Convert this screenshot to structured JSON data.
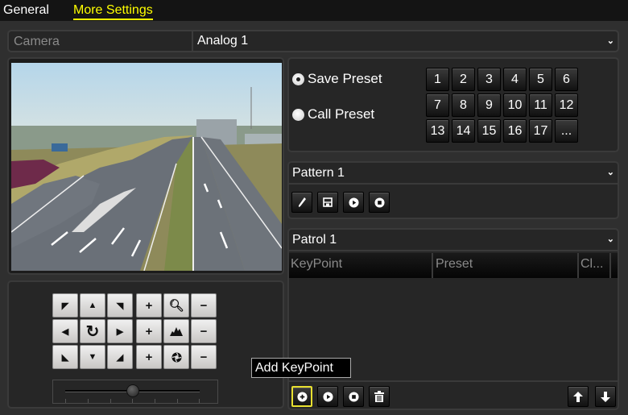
{
  "tabs": [
    {
      "label": "General",
      "active": false
    },
    {
      "label": "More Settings",
      "active": true
    }
  ],
  "camera": {
    "label": "Camera",
    "value": "Analog 1"
  },
  "preset": {
    "save_label": "Save Preset",
    "call_label": "Call Preset",
    "selected": "save",
    "numbers": [
      "1",
      "2",
      "3",
      "4",
      "5",
      "6",
      "7",
      "8",
      "9",
      "10",
      "11",
      "12",
      "13",
      "14",
      "15",
      "16",
      "17",
      "..."
    ]
  },
  "ptz": {
    "direction_icons": [
      "arrow-up-left-icon",
      "arrow-up-icon",
      "arrow-up-right-icon",
      "arrow-left-icon",
      "auto-scan-icon",
      "arrow-right-icon",
      "arrow-down-left-icon",
      "arrow-down-icon",
      "arrow-down-right-icon"
    ],
    "lens_rows": [
      {
        "name": "zoom",
        "icon": "zoom-icon",
        "plus": "+",
        "minus": "−"
      },
      {
        "name": "focus",
        "icon": "focus-icon",
        "plus": "+",
        "minus": "−"
      },
      {
        "name": "iris",
        "icon": "iris-icon",
        "plus": "+",
        "minus": "−"
      }
    ],
    "speed_level": 0.5
  },
  "pattern": {
    "selected": "Pattern 1",
    "buttons": [
      "edit-pattern-icon",
      "save-pattern-icon",
      "play-pattern-icon",
      "stop-pattern-icon"
    ]
  },
  "patrol": {
    "selected": "Patrol 1",
    "columns": [
      "KeyPoint",
      "Preset",
      "Cl..."
    ],
    "rows": [],
    "buttons": [
      "add-keypoint-icon",
      "play-patrol-icon",
      "stop-patrol-icon",
      "delete-keypoint-icon"
    ],
    "move_buttons": [
      "move-up-icon",
      "move-down-icon"
    ]
  },
  "tooltip": "Add KeyPoint"
}
